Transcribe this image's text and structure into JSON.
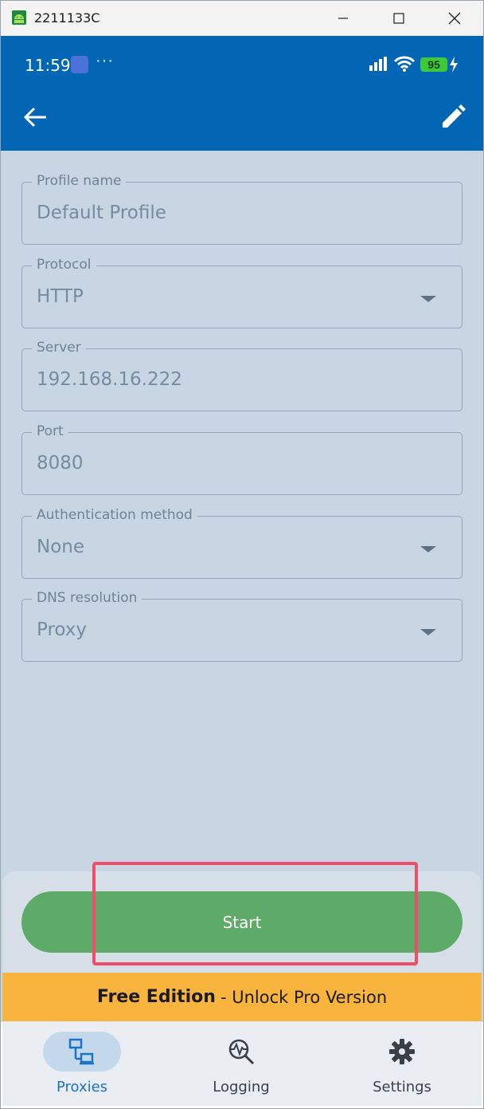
{
  "window": {
    "title": "2211133C"
  },
  "status_bar": {
    "time": "11:59",
    "more": "···",
    "battery": "95"
  },
  "fields": [
    {
      "label": "Profile name",
      "value": "Default Profile",
      "dropdown": false
    },
    {
      "label": "Protocol",
      "value": "HTTP",
      "dropdown": true
    },
    {
      "label": "Server",
      "value": "192.168.16.222",
      "dropdown": false
    },
    {
      "label": "Port",
      "value": "8080",
      "dropdown": false
    },
    {
      "label": "Authentication method",
      "value": "None",
      "dropdown": true
    },
    {
      "label": "DNS resolution",
      "value": "Proxy",
      "dropdown": true
    }
  ],
  "start_button": {
    "label": "Start"
  },
  "banner": {
    "bold": "Free Edition",
    "rest": "- Unlock Pro Version"
  },
  "nav": [
    {
      "label": "Proxies",
      "icon": "proxies-icon",
      "active": true
    },
    {
      "label": "Logging",
      "icon": "logging-icon",
      "active": false
    },
    {
      "label": "Settings",
      "icon": "gear-icon",
      "active": false
    }
  ],
  "colors": {
    "appbar": "#0366b4",
    "start": "#5eaa69",
    "banner": "#f8b43d",
    "nav_active": "#1a73c6",
    "highlight": "#f04d6a"
  }
}
